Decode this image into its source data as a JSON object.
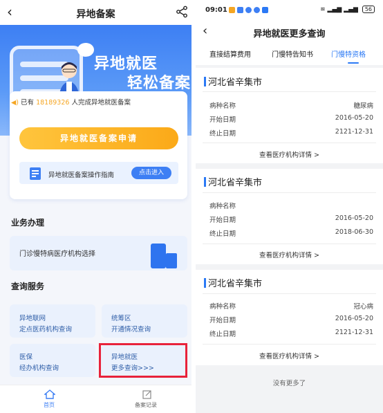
{
  "left": {
    "title": "异地备案",
    "back_icon": "‹",
    "hero": {
      "line1": "异地就医",
      "line2": "轻松备案"
    },
    "notice": {
      "prefix": "已有",
      "count": "18189326",
      "suffix": "人完成异地就医备案"
    },
    "apply_button": "异地就医备案申请",
    "guide": {
      "text": "异地就医备案操作指南",
      "button": "点击进入"
    },
    "section_business": "业务办理",
    "business_card": "门诊慢特病医疗机构选择",
    "section_query": "查询服务",
    "query_cards": [
      {
        "line1": "异地联网",
        "line2": "定点医药机构查询"
      },
      {
        "line1": "统筹区",
        "line2": "开通情况查询"
      },
      {
        "line1": "医保",
        "line2": "经办机构查询"
      },
      {
        "line1": "异地就医",
        "line2": "更多查询>>>"
      }
    ],
    "tabbar": {
      "home": "首页",
      "records": "备案记录"
    },
    "colors": {
      "primary": "#3d7ff4",
      "accent": "#fba918",
      "highlight": "#e8223a"
    }
  },
  "right": {
    "status": {
      "time": "09:01",
      "battery": "56"
    },
    "title": "异地就医更多查询",
    "back_icon": "‹",
    "tabs": [
      "直接结算费用",
      "门慢特告知书",
      "门慢特资格"
    ],
    "active_tab": "门慢特资格",
    "field_labels": {
      "disease": "病种名称",
      "start": "开始日期",
      "end": "终止日期"
    },
    "records": [
      {
        "region": "河北省辛集市",
        "disease": "糖尿病",
        "start": "2016-05-20",
        "end": "2121-12-31",
        "link": "查看医疗机构详情 >"
      },
      {
        "region": "河北省辛集市",
        "disease": "",
        "start": "2016-05-20",
        "end": "2018-06-30",
        "link": "查看医疗机构详情 >"
      },
      {
        "region": "河北省辛集市",
        "disease": "冠心病",
        "start": "2016-05-20",
        "end": "2121-12-31",
        "link": "查看医疗机构详情 >"
      }
    ],
    "no_more": "没有更多了",
    "colors": {
      "primary": "#2b79f5"
    }
  }
}
